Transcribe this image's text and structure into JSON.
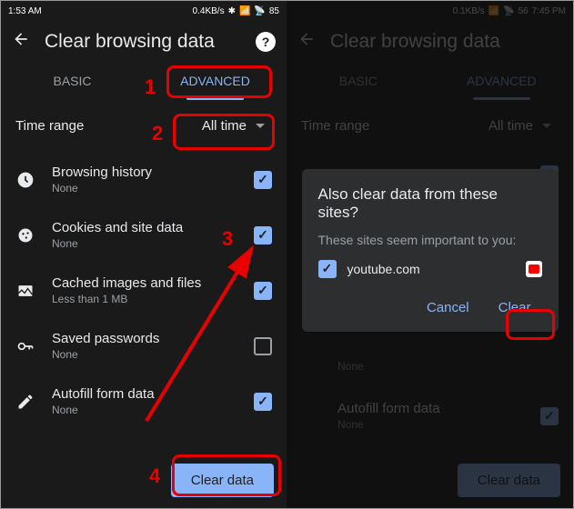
{
  "statusbar": {
    "left_time1": "1:53 AM",
    "left_speed1": "0.4KB/s",
    "right_batt1": "85",
    "left_time2": "7:45 PM",
    "left_speed2": "0.1KB/s",
    "right_batt2": "56"
  },
  "header": {
    "title": "Clear browsing data",
    "help": "?"
  },
  "tabs": {
    "basic": "BASIC",
    "advanced": "ADVANCED"
  },
  "timerange": {
    "label": "Time range",
    "value": "All time"
  },
  "options": {
    "history": {
      "title": "Browsing history",
      "sub": "None"
    },
    "cookies": {
      "title": "Cookies and site data",
      "sub": "None"
    },
    "cached": {
      "title": "Cached images and files",
      "sub": "Less than 1 MB"
    },
    "passwords": {
      "title": "Saved passwords",
      "sub": "None"
    },
    "autofill": {
      "title": "Autofill form data",
      "sub": "None"
    }
  },
  "footer": {
    "clear": "Clear data"
  },
  "dialog": {
    "title": "Also clear data from these sites?",
    "sub": "These sites seem important to you:",
    "site1": "youtube.com",
    "cancel": "Cancel",
    "clear": "Clear"
  },
  "annotations": {
    "n1": "1",
    "n2": "2",
    "n3": "3",
    "n4": "4"
  }
}
